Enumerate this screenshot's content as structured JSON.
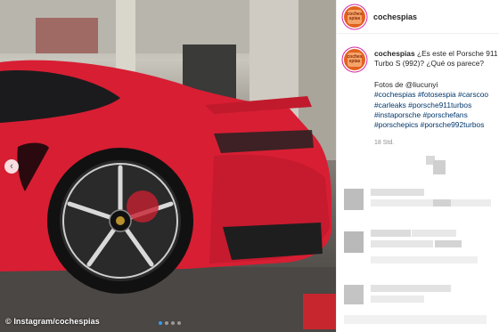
{
  "header": {
    "username": "cochespias",
    "avatar_text": "coches spias"
  },
  "caption": {
    "username": "cochespias",
    "text_line1": "¿Es este el Porsche 911",
    "text_line2": "Turbo S (992)? ¿Qué os parece?",
    "credit": "Fotos de @liucunyi",
    "hashtags": [
      "#cochespias #fotosespia #carscoo",
      "#carleaks #porsche911turbos",
      "#instaporsche #porschefans",
      "#porschepics #porsche992turbos"
    ],
    "timestamp": "18 Std."
  },
  "photo": {
    "watermark": "© Instagram/cochespias",
    "carousel_prev": "‹",
    "carousel_dots": 4,
    "active_dot": 1
  },
  "colors": {
    "car_red": "#d81e33",
    "tag_blue": "#00376b",
    "dot_active": "#3a9bf0"
  }
}
